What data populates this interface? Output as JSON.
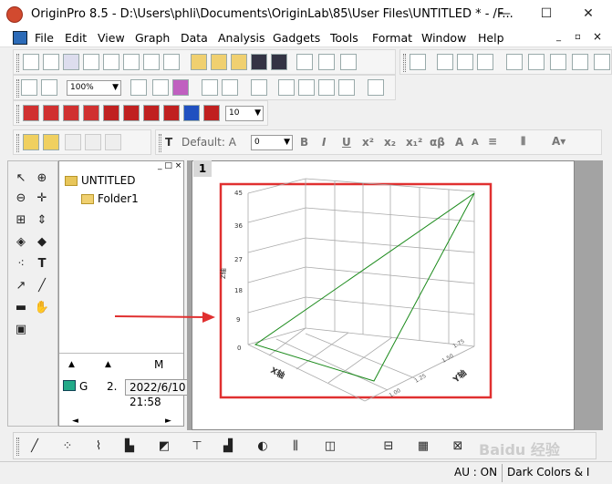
{
  "window": {
    "title": "OriginPro 8.5 - D:\\Users\\phli\\Documents\\OriginLab\\85\\User Files\\UNTITLED * - /F...",
    "minimize": "—",
    "maximize": "☐",
    "close": "✕"
  },
  "menu": {
    "items": [
      "File",
      "Edit",
      "View",
      "Graph",
      "Data",
      "Analysis",
      "Gadgets",
      "Tools",
      "Format",
      "Window",
      "Help"
    ],
    "mdi_controls": [
      "_",
      "▫",
      "×"
    ]
  },
  "toolbar": {
    "zoom_value": "100%",
    "color_combo": "10",
    "font_label": "Default: A",
    "font_size": "0",
    "format_buttons": [
      "B",
      "I",
      "U",
      "x²",
      "x₂",
      "x₁²",
      "αβ",
      "A",
      "A"
    ]
  },
  "explorer": {
    "project": "UNTITLED",
    "folder": "Folder1",
    "columns": [
      "▲",
      "▲",
      "M"
    ],
    "row_name": "G",
    "row_value": "2.",
    "tooltip": "2022/6/10 21:58",
    "scroll_left": "◄",
    "scroll_right": "►"
  },
  "graph": {
    "layer_number": "1",
    "y_ticks": [
      "45",
      "36",
      "27",
      "18",
      "9",
      "0"
    ],
    "x_ticks": [
      "1.25",
      "1.00",
      "0.75",
      "0.50",
      "0.25",
      "0.00"
    ],
    "x_axis_label": "X轴",
    "y_axis_label": "Y轴",
    "z_axis_label": "Z轴",
    "depth_ticks": [
      "1.75",
      "1.50",
      "1.25",
      "1.00"
    ],
    "frame_color": "#e03030",
    "line_color": "#1a8a1a",
    "arrow_color": "#e03030"
  },
  "chart_data": {
    "type": "line",
    "title": "",
    "zlim": [
      0,
      45
    ],
    "series": [
      {
        "values": [
          0,
          45,
          0,
          0,
          45,
          0
        ]
      }
    ]
  },
  "status": {
    "au": "AU : ON",
    "theme": "Dark Colors & I"
  },
  "watermark": "Baidu 经验"
}
